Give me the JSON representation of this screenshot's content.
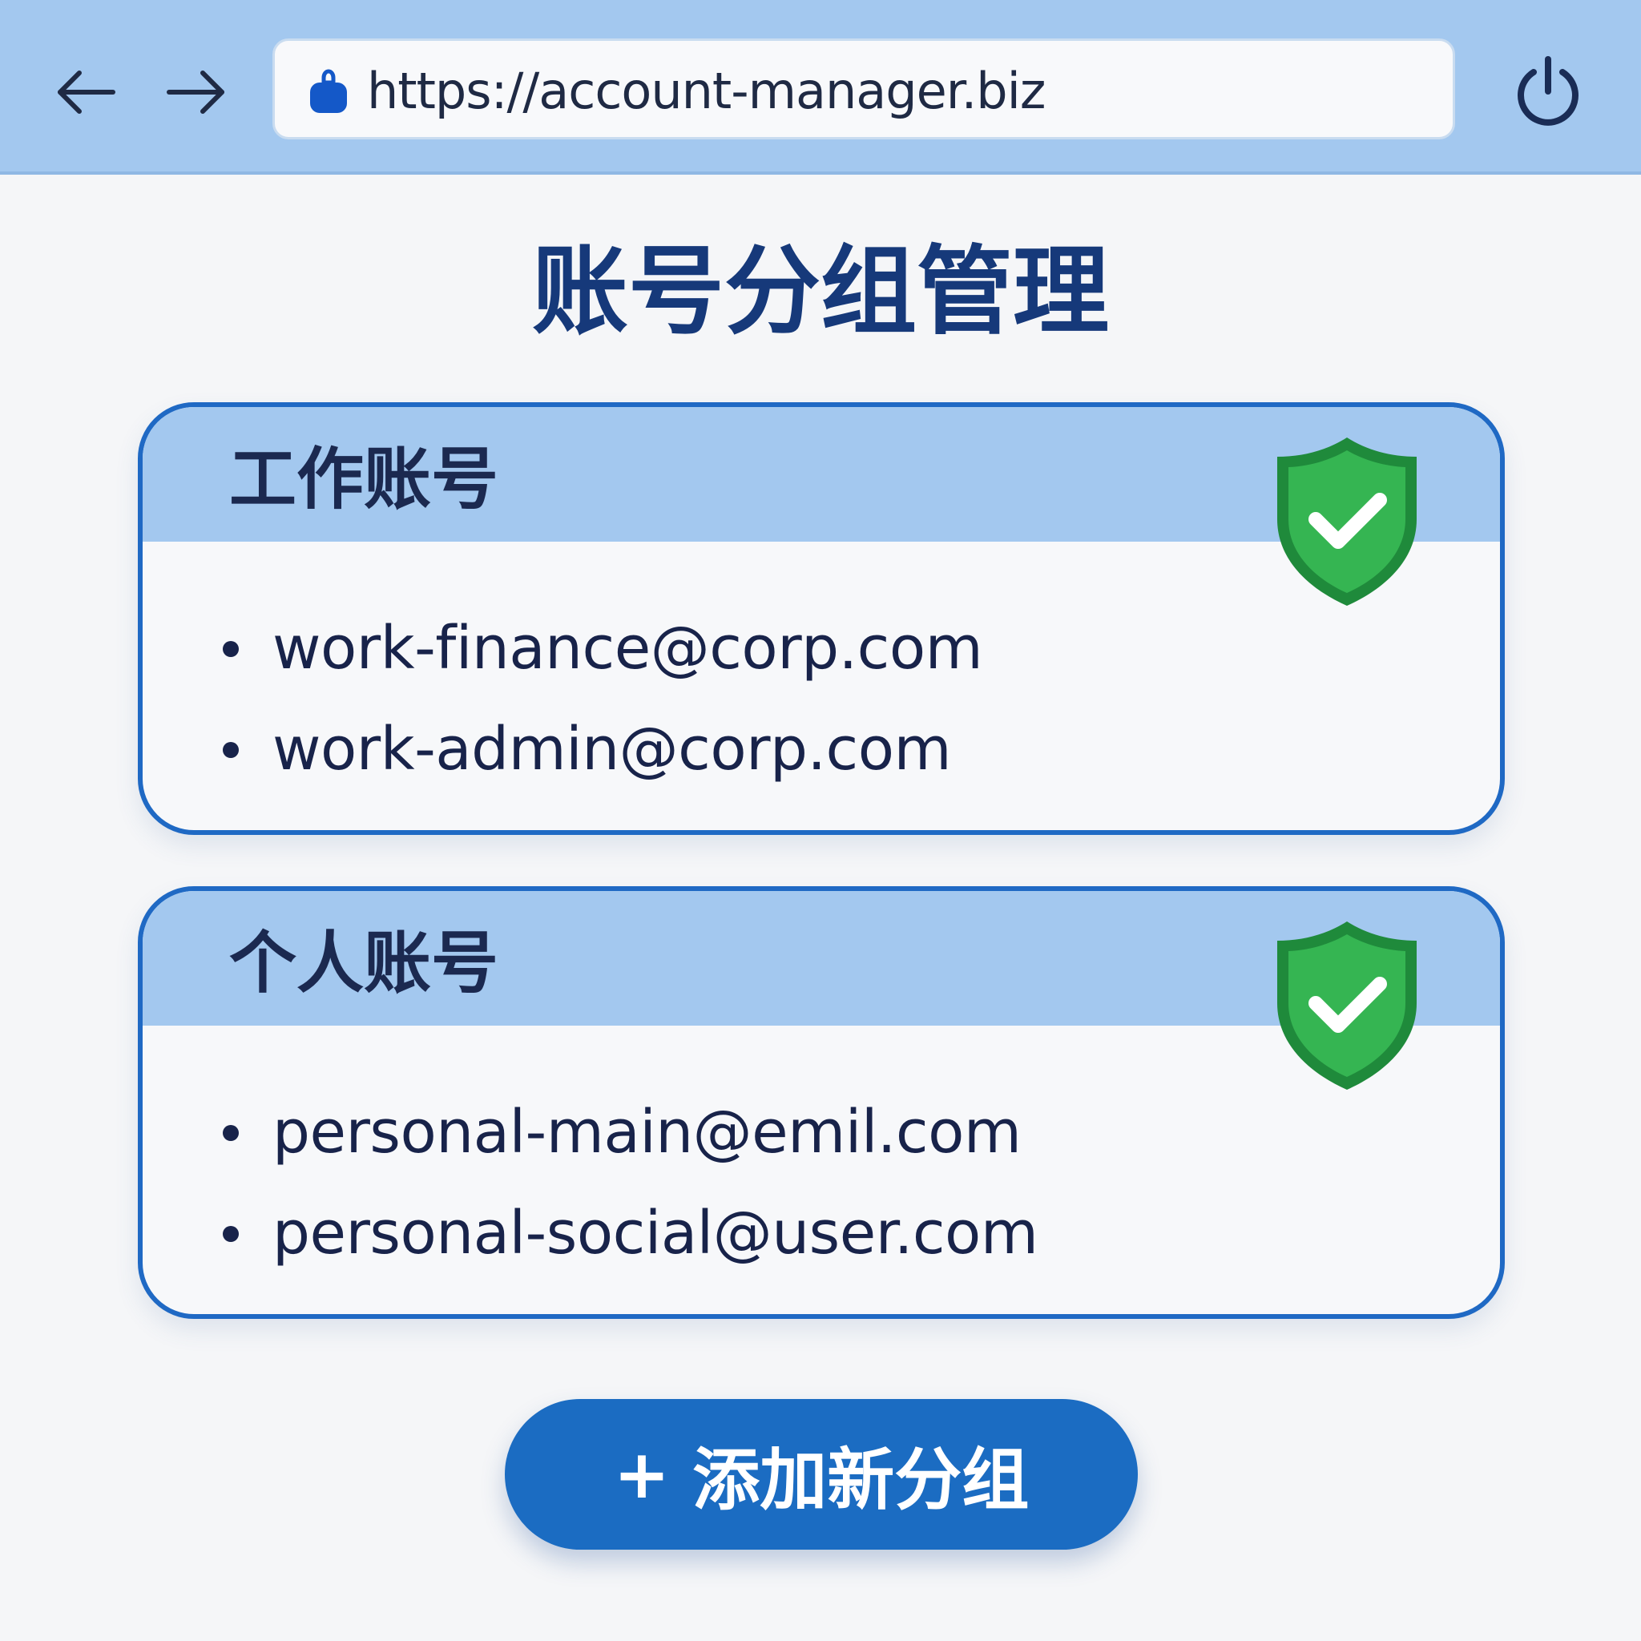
{
  "browser": {
    "url": "https://account-manager.biz",
    "back_icon": "arrow-left-icon",
    "forward_icon": "arrow-right-icon",
    "lock_icon": "lock-icon",
    "power_icon": "power-icon"
  },
  "page": {
    "title": "账号分组管理"
  },
  "groups": [
    {
      "title": "工作账号",
      "status_icon": "shield-check-icon",
      "accounts": [
        "work-finance@corp.com",
        "work-admin@corp.com"
      ]
    },
    {
      "title": "个人账号",
      "status_icon": "shield-check-icon",
      "accounts": [
        "personal-main@emil.com",
        "personal-social@user.com"
      ]
    }
  ],
  "actions": {
    "add_plus": "+",
    "add_group_label": "添加新分组"
  },
  "colors": {
    "toolbar": "#a3c8ef",
    "accent": "#1f69c4",
    "title": "#16397a",
    "shield_green": "#2fb14a",
    "button": "#1b6cc2"
  }
}
